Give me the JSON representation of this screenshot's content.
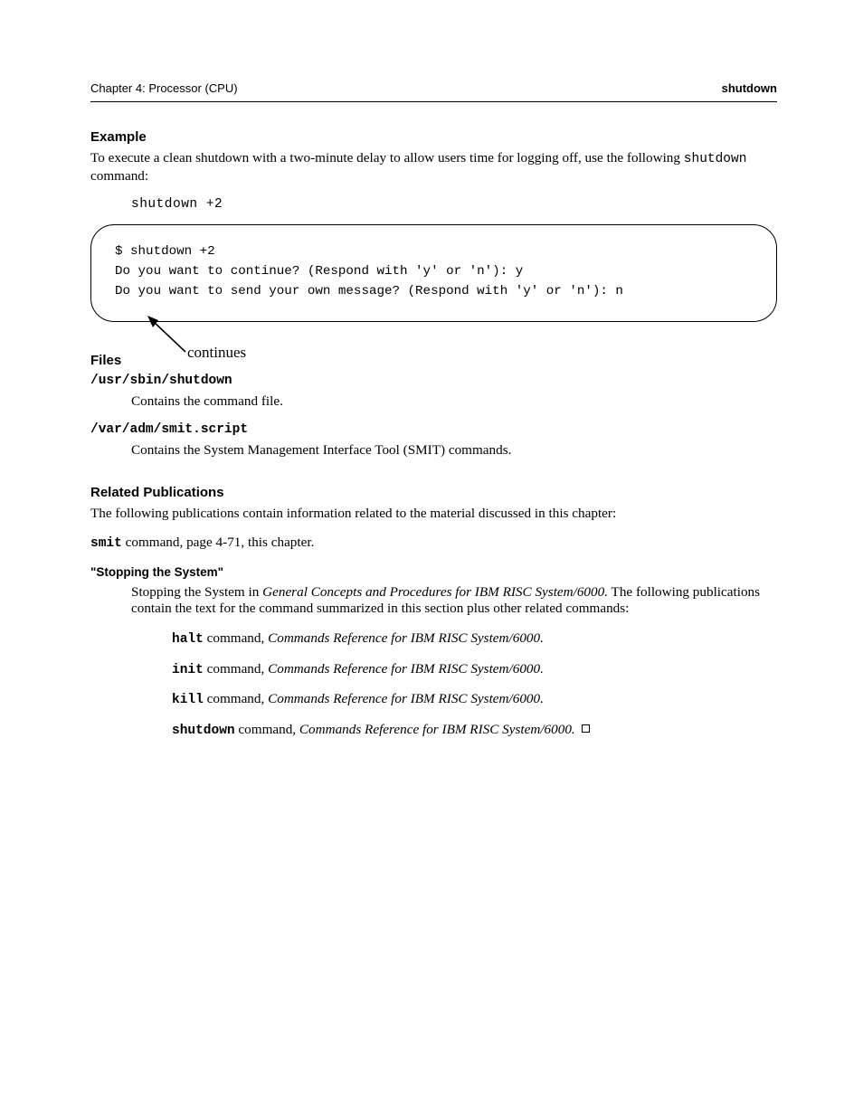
{
  "header": {
    "left": "Chapter 4: Processor (CPU)",
    "right": "shutdown"
  },
  "sec1": {
    "title": "Example",
    "p1a": "To execute a clean shutdown with a two-minute delay to allow users time for logging off, use the following ",
    "code1": "shutdown",
    "p1b": " command:",
    "indent_code": "shutdown   +2"
  },
  "box": {
    "line1": "$ shutdown +2",
    "line2": "Do you want to continue? (Respond with 'y' or 'n'):  y",
    "line3": "Do you want to send your own message? (Respond with 'y' or 'n'):  n",
    "handnote": "continues"
  },
  "sec2": {
    "title": "Files",
    "f1_path": "/usr/sbin/shutdown",
    "f1_desc": "Contains the command file.",
    "f2_path": "/var/adm/smit.script",
    "f2_desc": "Contains the System Management Interface Tool (SMIT) commands."
  },
  "sec3": {
    "title": "Related Publications",
    "intro": "The following publications contain information related to the material discussed in this chapter:",
    "item1_head": "smit",
    "item1_rest": " command, page 4-71, this chapter.",
    "item2_head": "\"Stopping the System\"",
    "item2_body_a": "Stopping the System in ",
    "item2_body_b_ital": "General Concepts and Procedures for IBM RISC System/6000.",
    "item2_body_c": " The following publications contain the text for the command summarized in this section plus other related commands:",
    "sub1_a": "halt",
    "sub1_b": " command, ",
    "sub1_ital": "Commands Reference for IBM RISC System/6000.",
    "sub2_a": "init",
    "sub2_b": " command, ",
    "sub2_ital": "Commands Reference for IBM RISC System/6000.",
    "sub3_a": "kill",
    "sub3_b": " command, ",
    "sub3_ital": "Commands Reference for IBM RISC System/6000.",
    "sub4_a": "shutdown",
    "sub4_b": " command, ",
    "sub4_ital": "Commands Reference for IBM RISC System/6000.",
    "endmark": ""
  }
}
